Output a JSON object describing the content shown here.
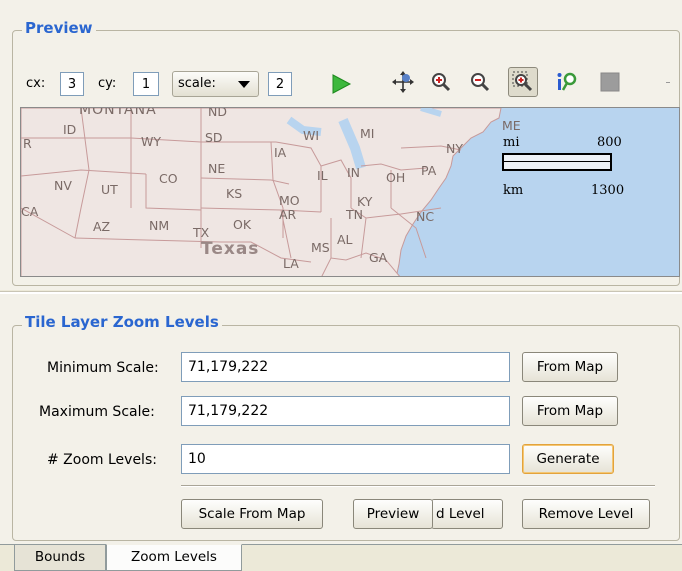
{
  "preview": {
    "legend": "Preview",
    "cx_label": "cx:",
    "cx_value": "3",
    "cy_label": "cy:",
    "cy_value": "1",
    "scale_select": "scale:",
    "scale_value": "2",
    "tools": [
      "play-icon",
      "pan-icon",
      "zoom-in-icon",
      "zoom-out-icon",
      "zoom-box-icon",
      "identify-icon",
      "stop-icon"
    ],
    "map": {
      "states": [
        "ID",
        "MONTANA",
        "ND",
        "WY",
        "SD",
        "WI",
        "MI",
        "ME",
        "NY",
        "IA",
        "NE",
        "NV",
        "UT",
        "CO",
        "IL",
        "IN",
        "OH",
        "PA",
        "KS",
        "MO",
        "CA",
        "KY",
        "AR",
        "OK",
        "TN",
        "NC",
        "AZ",
        "NM",
        "TX",
        "Texas",
        "MS",
        "AL",
        "GA",
        "LA",
        "R"
      ],
      "scalebar": {
        "top_unit": "mi",
        "top_value": "800",
        "bottom_unit": "km",
        "bottom_value": "1300"
      },
      "colors": {
        "land": "#efe6e3",
        "water": "#b8d4ef",
        "border": "#c79a9a"
      }
    }
  },
  "zoom_levels": {
    "legend": "Tile Layer Zoom Levels",
    "min_scale_label": "Minimum Scale:",
    "min_scale_value": "71,179,222",
    "max_scale_label": "Maximum Scale:",
    "max_scale_value": "71,179,222",
    "zoom_count_label": "# Zoom Levels:",
    "zoom_count_value": "10",
    "from_map_1": "From Map",
    "from_map_2": "From Map",
    "generate": "Generate",
    "scale_from_map": "Scale From Map",
    "preview_btn": "Preview",
    "add_level": "d Level",
    "remove_level": "Remove Level"
  },
  "tabs": [
    "Bounds",
    "Zoom Levels"
  ],
  "accent": "#2a66d0"
}
